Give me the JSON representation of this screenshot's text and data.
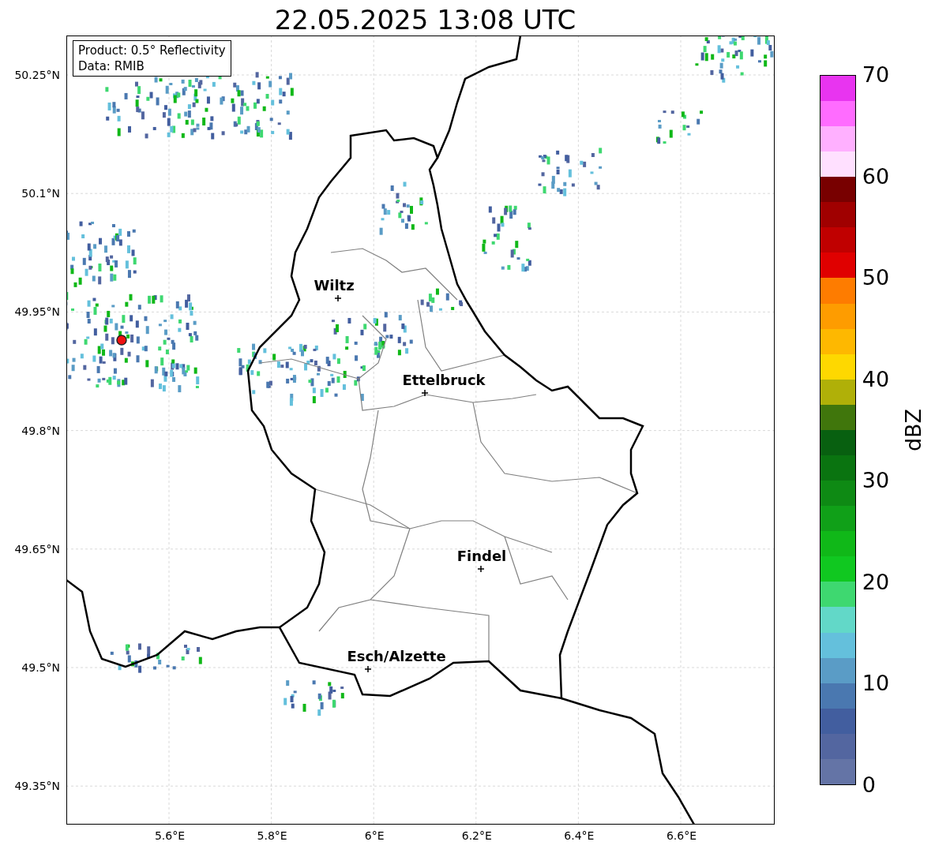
{
  "title": "22.05.2025 13:08 UTC",
  "legend": [
    "Product: 0.5° Reflectivity",
    "Data: RMIB"
  ],
  "x_ticks": [
    "5.6°E",
    "5.8°E",
    "6°E",
    "6.2°E",
    "6.4°E",
    "6.6°E"
  ],
  "y_ticks": [
    "50.25°N",
    "50.1°N",
    "49.95°N",
    "49.8°N",
    "49.65°N",
    "49.5°N",
    "49.35°N"
  ],
  "cities": [
    {
      "name": "Wiltz"
    },
    {
      "name": "Ettelbruck"
    },
    {
      "name": "Findel"
    },
    {
      "name": "Esch/Alzette"
    }
  ],
  "colorbar": {
    "label": "dBZ",
    "ticks": [
      "70",
      "60",
      "50",
      "40",
      "30",
      "20",
      "10",
      "0"
    ],
    "bins": [
      {
        "color": "#6474a6"
      },
      {
        "color": "#5366a0"
      },
      {
        "color": "#425e9f"
      },
      {
        "color": "#4a78b0"
      },
      {
        "color": "#5a9cc6"
      },
      {
        "color": "#64c0dc"
      },
      {
        "color": "#62d8c8"
      },
      {
        "color": "#3ed870"
      },
      {
        "color": "#10c820"
      },
      {
        "color": "#10b818"
      },
      {
        "color": "#10a018"
      },
      {
        "color": "#0e8a14"
      },
      {
        "color": "#0a7410"
      },
      {
        "color": "#086010"
      },
      {
        "color": "#40760c"
      },
      {
        "color": "#b0b008"
      },
      {
        "color": "#fed800"
      },
      {
        "color": "#feb800"
      },
      {
        "color": "#fe9c00"
      },
      {
        "color": "#fe7c00"
      },
      {
        "color": "#e00000"
      },
      {
        "color": "#c00000"
      },
      {
        "color": "#a00000"
      },
      {
        "color": "#780000"
      },
      {
        "color": "#ffe0ff"
      },
      {
        "color": "#ffb0ff"
      },
      {
        "color": "#ff6cff"
      },
      {
        "color": "#e834f0"
      }
    ]
  }
}
